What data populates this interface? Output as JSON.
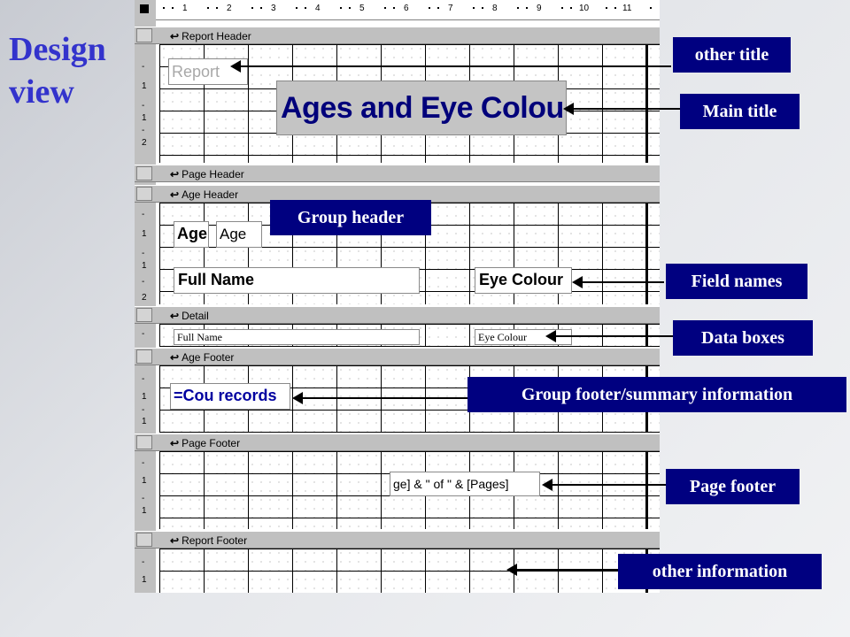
{
  "slide_title": {
    "line1": "Design",
    "line2": "view"
  },
  "ruler": {
    "numbers": [
      "1",
      "2",
      "3",
      "4",
      "5",
      "6",
      "7",
      "8",
      "9",
      "10",
      "11"
    ]
  },
  "vertical_ruler": {
    "report_header": [
      "-",
      "1",
      "-",
      "1",
      "-",
      "2"
    ],
    "age_header": [
      "-",
      "1",
      "-",
      "1",
      "-",
      "2"
    ],
    "detail": [
      "-"
    ],
    "age_footer": [
      "-",
      "1",
      "-",
      "1"
    ],
    "page_footer": [
      "-",
      "1",
      "-",
      "1"
    ],
    "report_footer": [
      "-",
      "1"
    ]
  },
  "sections": {
    "report_header": "Report Header",
    "page_header": "Page Header",
    "age_header": "Age Header",
    "detail": "Detail",
    "age_footer": "Age Footer",
    "page_footer": "Page Footer",
    "report_footer": "Report Footer"
  },
  "controls": {
    "report_label": "Report",
    "main_title": "Ages and Eye Colours",
    "age_label": "Age",
    "age_textbox": "Age",
    "full_name_label": "Full Name",
    "eye_colour_label": "Eye Colour",
    "full_name_textbox": "Full Name",
    "eye_colour_textbox": "Eye Colour",
    "count_textbox": "=Cou records",
    "pages_textbox": "ge] & \" of \" & [Pages]"
  },
  "callouts": {
    "other_title": "other title",
    "main_title": "Main title",
    "group_header": "Group header",
    "field_names": "Field names",
    "data_boxes": "Data boxes",
    "group_footer": "Group footer/summary information",
    "page_footer": "Page footer",
    "other_information": "other information"
  },
  "colors": {
    "title": "#3333cc",
    "callout_bg": "#000080",
    "main_title_text": "#00007a"
  }
}
